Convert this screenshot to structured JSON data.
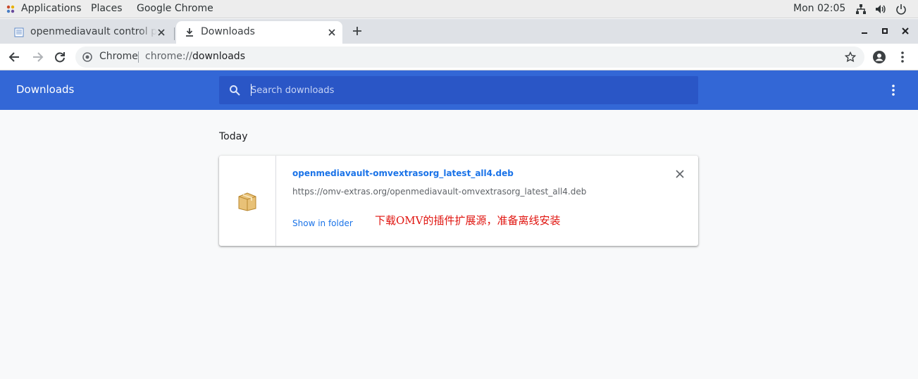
{
  "topbar": {
    "applications": "Applications",
    "places": "Places",
    "app_menu": "Google Chrome",
    "clock": "Mon 02:05",
    "tray_icons": [
      "network-icon",
      "volume-icon",
      "power-icon"
    ]
  },
  "tabs": [
    {
      "title": "openmediavault control panel",
      "icon": "page-icon",
      "active": false
    },
    {
      "title": "Downloads",
      "icon": "download-icon",
      "active": true
    }
  ],
  "toolbar": {
    "site_chip": "Chrome",
    "url_scheme": "chrome://",
    "url_path": "downloads"
  },
  "downloads": {
    "title": "Downloads",
    "search_placeholder": "Search downloads",
    "section_date": "Today",
    "items": [
      {
        "file_name": "openmediavault-omvextrasorg_latest_all4.deb",
        "url": "https://omv-extras.org/openmediavault-omvextrasorg_latest_all4.deb",
        "action": "Show in folder",
        "icon": "package-icon"
      }
    ]
  },
  "annotation": "下载OMV的插件扩展源，准备离线安装",
  "colors": {
    "header_blue": "#3367d6",
    "search_blue": "#2a56c6",
    "link_blue": "#1a73e8",
    "annotation_red": "#e0140f"
  }
}
